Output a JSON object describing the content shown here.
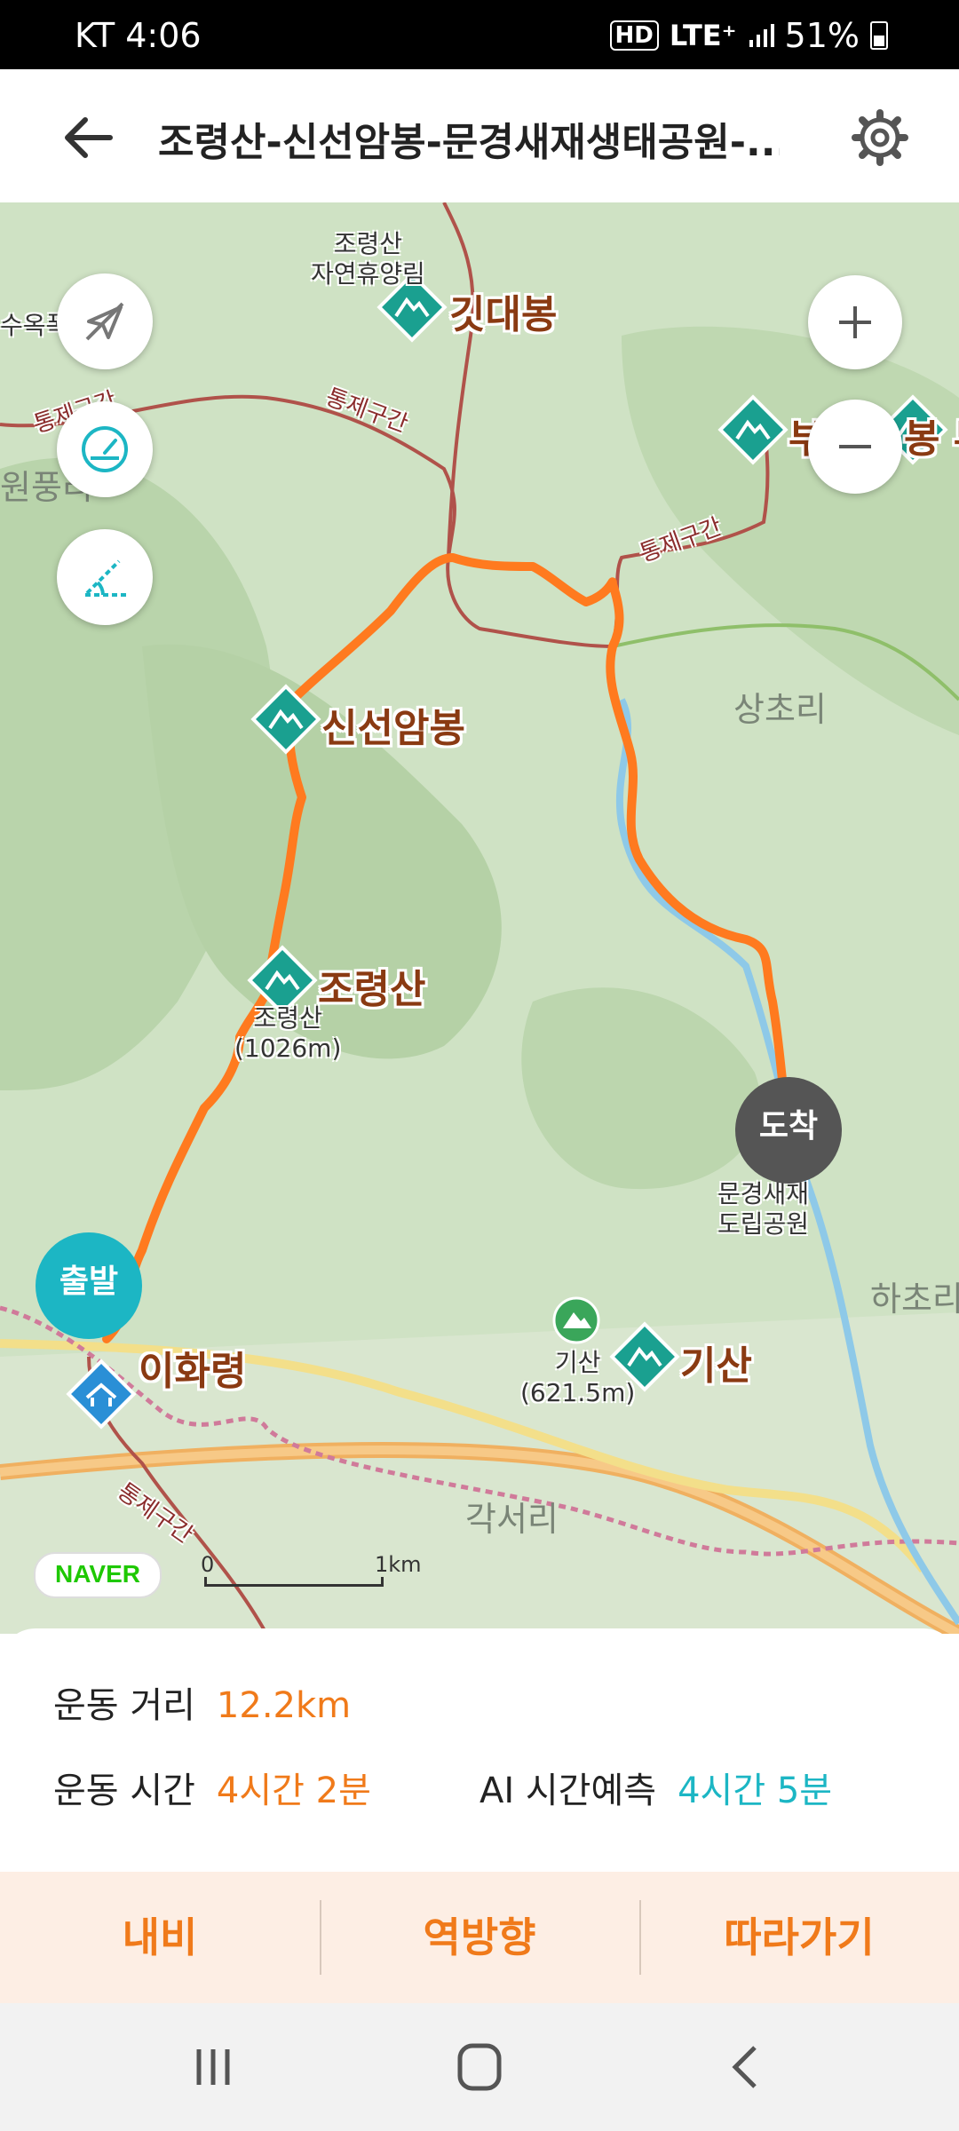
{
  "status_bar": {
    "carrier_time": "KT 4:06",
    "network": "HD",
    "signal": "LTE⁺",
    "battery": "51%"
  },
  "header": {
    "title": "조령산-신선암봉-문경새재생태공원-..."
  },
  "map": {
    "peaks": {
      "gitdaebong": "깃대봉",
      "sinseonambong": "신선암봉",
      "joryeongsan": "조령산",
      "gisan": "기산",
      "bu_partial": "부",
      "bong_partial": "봉 부"
    },
    "places": {
      "ihwaryeong": "이화령",
      "joryeong_forest": "조령산\n자연휴양림",
      "joryeong_height": "조령산\n(1026m)",
      "gisan_height": "기산\n(621.5m)",
      "park": "문경새재\n도립공원",
      "waterfall_partial": "수옥폭",
      "wonpung_partial": "원풍리"
    },
    "regions": {
      "sangcho": "상초리",
      "hacho": "하초리",
      "gakseo": "각서리"
    },
    "restricted": "통제구간",
    "markers": {
      "start": "출발",
      "end": "도착"
    },
    "attribution": "NAVER",
    "scale": {
      "zero": "0",
      "unit": "1km"
    }
  },
  "stats": {
    "distance_label": "운동 거리",
    "distance_value": "12.2km",
    "time_label": "운동 시간",
    "time_value": "4시간 2분",
    "ai_label": "AI 시간예측",
    "ai_value": "4시간 5분"
  },
  "actions": {
    "navi": "내비",
    "reverse": "역방향",
    "follow": "따라가기"
  },
  "colors": {
    "route": "#ff7a1f",
    "accent_orange": "#f07a1a",
    "accent_teal": "#1cb6c4"
  }
}
